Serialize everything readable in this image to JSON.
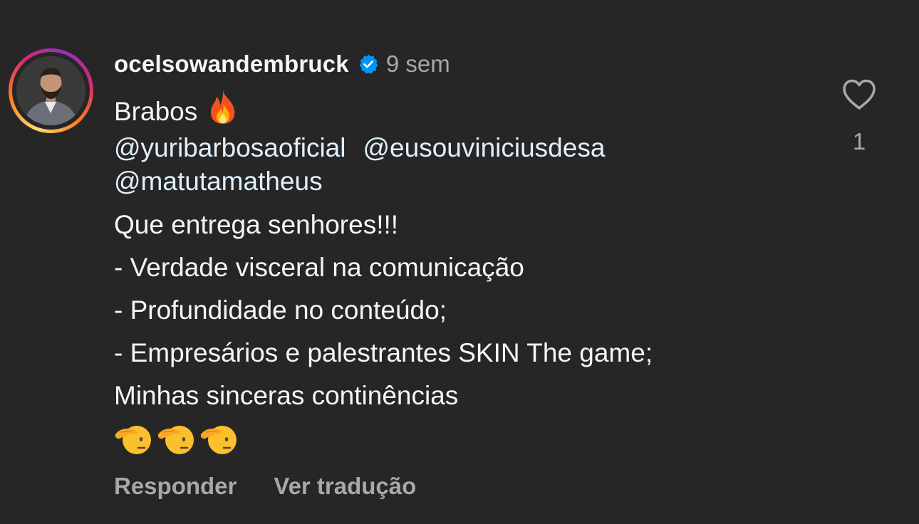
{
  "comment": {
    "username": "ocelsowandembruck",
    "verified_icon": "verified-badge-icon",
    "timestamp": "9 sem",
    "lines": {
      "l1": "Brabos",
      "mentions": [
        "@yuribarbosaoficial",
        "@eusouviniciusdesa",
        "@matutamatheus"
      ],
      "l3": "Que entrega senhores!!!",
      "l4": "- Verdade visceral na comunicação",
      "l5": "- Profundidade no conteúdo;",
      "l6": "- Empresários e palestrantes SKIN The game;",
      "l7": "Minhas sinceras continências"
    },
    "emojis": [
      "fire-emoji",
      "saluting-face-emoji",
      "saluting-face-emoji",
      "saluting-face-emoji"
    ],
    "actions": {
      "reply": "Responder",
      "translate": "Ver tradução"
    },
    "like_count": "1",
    "colors": {
      "background": "#262626",
      "text": "#f5f5f5",
      "muted": "#a8a8a8",
      "mention": "#e0f1ff",
      "verified": "#0095f6"
    }
  }
}
